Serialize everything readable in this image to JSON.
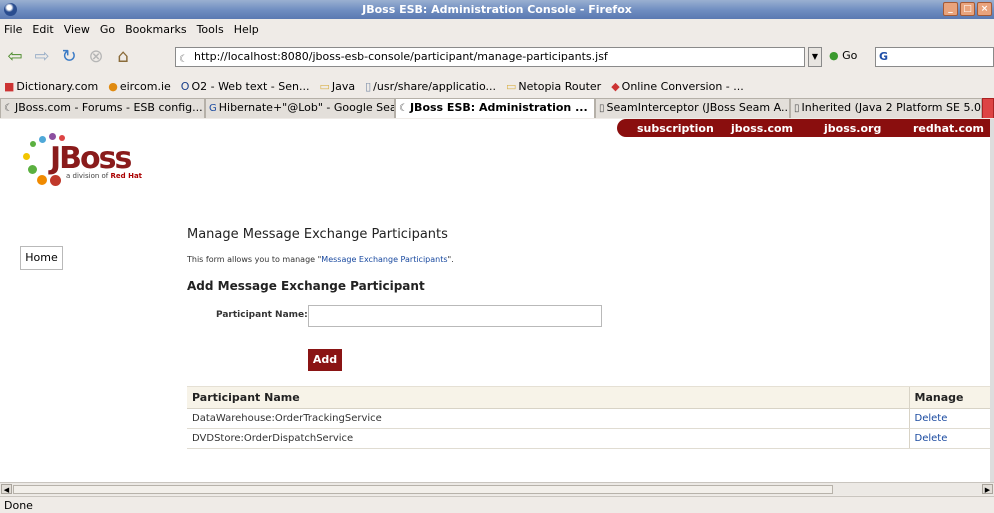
{
  "window": {
    "title": "JBoss ESB: Administration Console - Firefox"
  },
  "menu": [
    "File",
    "Edit",
    "View",
    "Go",
    "Bookmarks",
    "Tools",
    "Help"
  ],
  "nav": {
    "url": "http://localhost:8080/jboss-esb-console/participant/manage-participants.jsf",
    "go_label": "Go",
    "search_value": "G"
  },
  "bookmarks": [
    {
      "label": "Dictionary.com",
      "icon": "dictionary-icon"
    },
    {
      "label": "eircom.ie",
      "icon": "eircom-icon"
    },
    {
      "label": "O2 - Web text - Sen...",
      "icon": "o2-icon"
    },
    {
      "label": "Java",
      "icon": "folder-icon"
    },
    {
      "label": "/usr/share/applicatio...",
      "icon": "page-icon"
    },
    {
      "label": "Netopia Router",
      "icon": "folder-icon"
    },
    {
      "label": "Online Conversion - ...",
      "icon": "conversion-icon"
    }
  ],
  "tabs": [
    {
      "label": "JBoss.com - Forums - ESB config..."
    },
    {
      "label": "Hibernate+\"@Lob\" - Google Sea..."
    },
    {
      "label": "JBoss ESB: Administration ...",
      "active": true
    },
    {
      "label": "SeamInterceptor (JBoss Seam A..."
    },
    {
      "label": "Inherited (Java 2 Platform SE 5.0)"
    }
  ],
  "page": {
    "top_links": [
      "subscription",
      "jboss.com",
      "jboss.org",
      "redhat.com"
    ],
    "logo_subtitle_prefix": "a division of",
    "logo_subtitle_brand": "Red Hat",
    "home_label": "Home",
    "heading": "Manage Message Exchange Participants",
    "intro_prefix": "This form allows you to manage \"",
    "intro_link": "Message Exchange Participants",
    "intro_suffix": "\".",
    "add_heading": "Add Message Exchange Participant",
    "participant_label": "Participant Name:",
    "participant_value": "",
    "add_button": "Add",
    "table": {
      "headers": [
        "Participant Name",
        "Manage"
      ],
      "rows": [
        {
          "name": "DataWarehouse:OrderTrackingService",
          "action": "Delete"
        },
        {
          "name": "DVDStore:OrderDispatchService",
          "action": "Delete"
        }
      ]
    }
  },
  "status": "Done"
}
